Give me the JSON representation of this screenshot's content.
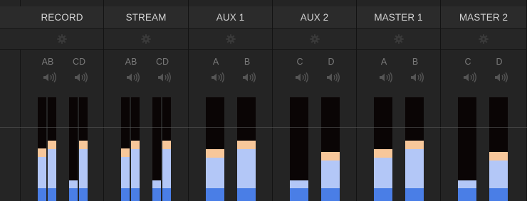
{
  "strips": [
    {
      "name": "RECORD",
      "channels": [
        "AB",
        "CD"
      ],
      "levels": [
        0.51,
        0.58
      ],
      "pair_meters": true
    },
    {
      "name": "STREAM",
      "channels": [
        "AB",
        "CD"
      ],
      "levels": [
        0.51,
        0.58
      ],
      "pair_meters": true
    },
    {
      "name": "AUX 1",
      "channels": [
        "A",
        "B"
      ],
      "levels": [
        0.5,
        0.58
      ],
      "pair_meters": false
    },
    {
      "name": "AUX 2",
      "channels": [
        "C",
        "D"
      ],
      "levels": [
        0.2,
        0.47
      ],
      "pair_meters": false
    },
    {
      "name": "MASTER 1",
      "channels": [
        "A",
        "B"
      ],
      "levels": [
        0.5,
        0.58
      ],
      "pair_meters": false
    },
    {
      "name": "MASTER 2",
      "channels": [
        "C",
        "D"
      ],
      "levels": [
        0.2,
        0.47
      ],
      "pair_meters": false
    }
  ],
  "icons": {
    "settings": "gear-icon",
    "mute": "speaker-icon"
  },
  "colors": {
    "peak": "#f7c79a",
    "mid": "#b3c7f7",
    "base": "#4a7ee6",
    "background": "#1f1f1f"
  }
}
